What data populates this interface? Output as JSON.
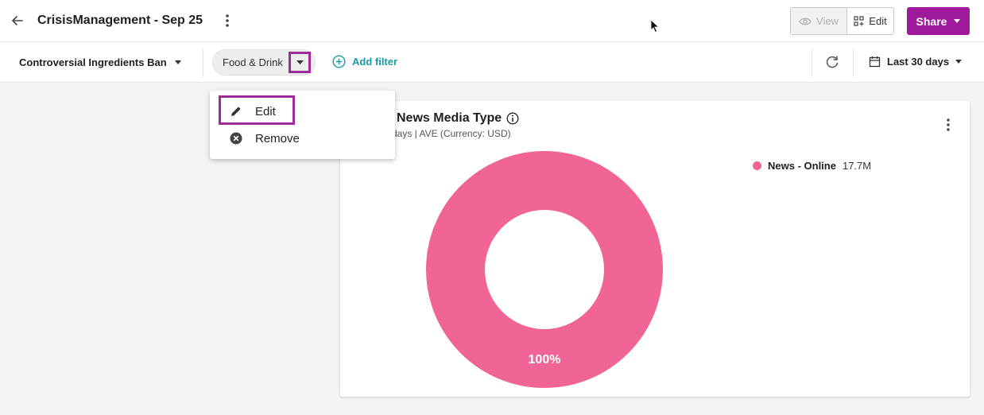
{
  "header": {
    "title": "CrisisManagement - Sep 25",
    "view_label": "View",
    "edit_label": "Edit",
    "share_label": "Share"
  },
  "filterbar": {
    "topic": "Controversial Ingredients Ban",
    "chip_label": "Food & Drink",
    "add_filter": "Add filter",
    "date_range": "Last 30 days"
  },
  "menu": {
    "items": [
      {
        "label": "Edit",
        "icon": "pencil-icon"
      },
      {
        "label": "Remove",
        "icon": "remove-circle-icon"
      }
    ]
  },
  "card": {
    "title": "News Media Type",
    "subtitle": "days | AVE (Currency: USD)",
    "legend": [
      {
        "name": "News - Online",
        "value": "17.7M",
        "color": "#f06595"
      }
    ]
  },
  "chart_data": {
    "type": "pie",
    "categories": [
      "News - Online"
    ],
    "values": [
      100
    ],
    "data_labels": [
      "100%"
    ],
    "colors": [
      "#f06595"
    ],
    "legend_position": "top-right"
  },
  "colors": {
    "accent": "#a0199c",
    "highlight": "#9b2c98",
    "link": "#1b9aa5",
    "slice": "#f06595"
  }
}
